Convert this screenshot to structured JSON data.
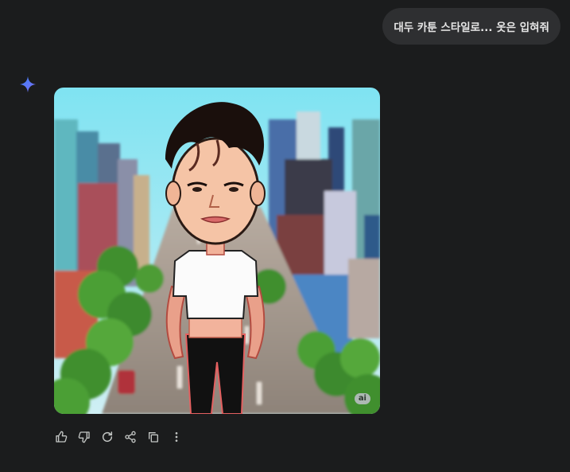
{
  "conversation": {
    "user_message": "대두 카툰 스타일로... 옷은 입혀줘"
  },
  "response": {
    "image": {
      "badge": "ai",
      "subject": "caricature"
    },
    "actions": [
      {
        "name": "thumbs-up",
        "icon": "thumb-up-icon"
      },
      {
        "name": "thumbs-down",
        "icon": "thumb-down-icon"
      },
      {
        "name": "regenerate",
        "icon": "refresh-icon"
      },
      {
        "name": "share",
        "icon": "share-icon"
      },
      {
        "name": "copy",
        "icon": "copy-icon"
      },
      {
        "name": "more",
        "icon": "more-vertical-icon"
      }
    ]
  },
  "colors": {
    "background": "#1b1c1d",
    "bubble": "#2e2f31",
    "icon": "#c4c7c5",
    "spark_start": "#4f8cff",
    "spark_end": "#9b6bff"
  }
}
